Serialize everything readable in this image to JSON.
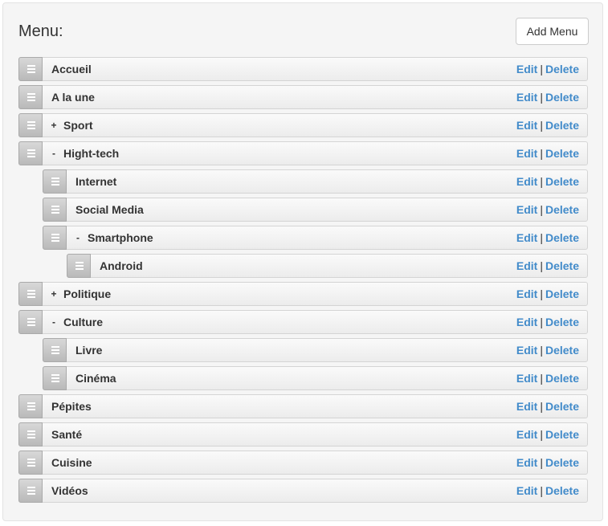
{
  "header": {
    "title": "Menu:",
    "add_label": "Add Menu"
  },
  "actions": {
    "edit_label": "Edit",
    "separator": "|",
    "delete_label": "Delete"
  },
  "items": [
    {
      "label": "Accueil",
      "depth": 0,
      "toggle": ""
    },
    {
      "label": "A la une",
      "depth": 0,
      "toggle": ""
    },
    {
      "label": "Sport",
      "depth": 0,
      "toggle": "+"
    },
    {
      "label": "Hight-tech",
      "depth": 0,
      "toggle": "-"
    },
    {
      "label": "Internet",
      "depth": 1,
      "toggle": ""
    },
    {
      "label": "Social Media",
      "depth": 1,
      "toggle": ""
    },
    {
      "label": "Smartphone",
      "depth": 1,
      "toggle": "-"
    },
    {
      "label": "Android",
      "depth": 2,
      "toggle": ""
    },
    {
      "label": "Politique",
      "depth": 0,
      "toggle": "+"
    },
    {
      "label": "Culture",
      "depth": 0,
      "toggle": "-"
    },
    {
      "label": "Livre",
      "depth": 1,
      "toggle": ""
    },
    {
      "label": "Cinéma",
      "depth": 1,
      "toggle": ""
    },
    {
      "label": "Pépites",
      "depth": 0,
      "toggle": ""
    },
    {
      "label": "Santé",
      "depth": 0,
      "toggle": ""
    },
    {
      "label": "Cuisine",
      "depth": 0,
      "toggle": ""
    },
    {
      "label": "Vidéos",
      "depth": 0,
      "toggle": ""
    }
  ]
}
